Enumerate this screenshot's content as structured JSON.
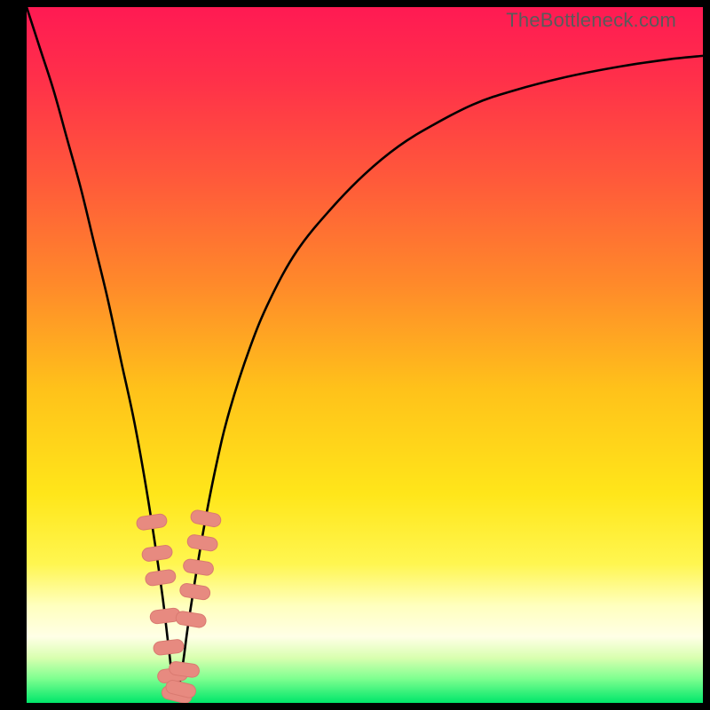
{
  "watermark": "TheBottleneck.com",
  "colors": {
    "frame": "#000000",
    "curve": "#000000",
    "marker_fill": "#e78a80",
    "marker_stroke": "#d97a70",
    "gradient_stops": [
      {
        "offset": 0.0,
        "color": "#ff1a53"
      },
      {
        "offset": 0.1,
        "color": "#ff2f4a"
      },
      {
        "offset": 0.25,
        "color": "#ff5a3a"
      },
      {
        "offset": 0.4,
        "color": "#ff8a2a"
      },
      {
        "offset": 0.55,
        "color": "#ffc21a"
      },
      {
        "offset": 0.7,
        "color": "#ffe61a"
      },
      {
        "offset": 0.8,
        "color": "#fff650"
      },
      {
        "offset": 0.86,
        "color": "#ffffbe"
      },
      {
        "offset": 0.905,
        "color": "#ffffe6"
      },
      {
        "offset": 0.935,
        "color": "#d9ffb0"
      },
      {
        "offset": 0.965,
        "color": "#7fff90"
      },
      {
        "offset": 1.0,
        "color": "#00e66a"
      }
    ]
  },
  "chart_data": {
    "type": "line",
    "title": "",
    "xlabel": "",
    "ylabel": "",
    "x_range": [
      0,
      100
    ],
    "y_range": [
      0,
      100
    ],
    "note": "Bottleneck-style V curve. x is a normalized hardware-balance axis (0–100); y is bottleneck severity % (0 = no bottleneck / green, 100 = severe / red). Minimum at x≈22. Values estimated from plot.",
    "series": [
      {
        "name": "bottleneck-curve",
        "x": [
          0,
          2,
          4,
          6,
          8,
          10,
          12,
          14,
          16,
          18,
          20,
          21,
          22,
          23,
          24,
          26,
          28,
          30,
          33,
          36,
          40,
          45,
          50,
          55,
          60,
          66,
          72,
          80,
          88,
          95,
          100
        ],
        "y": [
          100,
          94,
          88,
          81,
          74,
          66,
          58,
          49,
          40,
          29,
          16,
          8,
          1,
          5,
          12,
          24,
          34,
          42,
          51,
          58,
          65,
          71,
          76,
          80,
          83,
          86,
          88,
          90,
          91.5,
          92.5,
          93
        ]
      }
    ],
    "markers": {
      "name": "highlighted-points",
      "shape": "capsule",
      "x": [
        18.5,
        19.3,
        19.8,
        20.5,
        21.0,
        21.6,
        22.2,
        22.8,
        23.3,
        24.3,
        24.9,
        25.4,
        26.0,
        26.5
      ],
      "y": [
        26.0,
        21.5,
        18.0,
        12.5,
        8.0,
        4.0,
        1.2,
        2.0,
        4.8,
        12.0,
        16.0,
        19.5,
        23.0,
        26.5
      ]
    }
  }
}
